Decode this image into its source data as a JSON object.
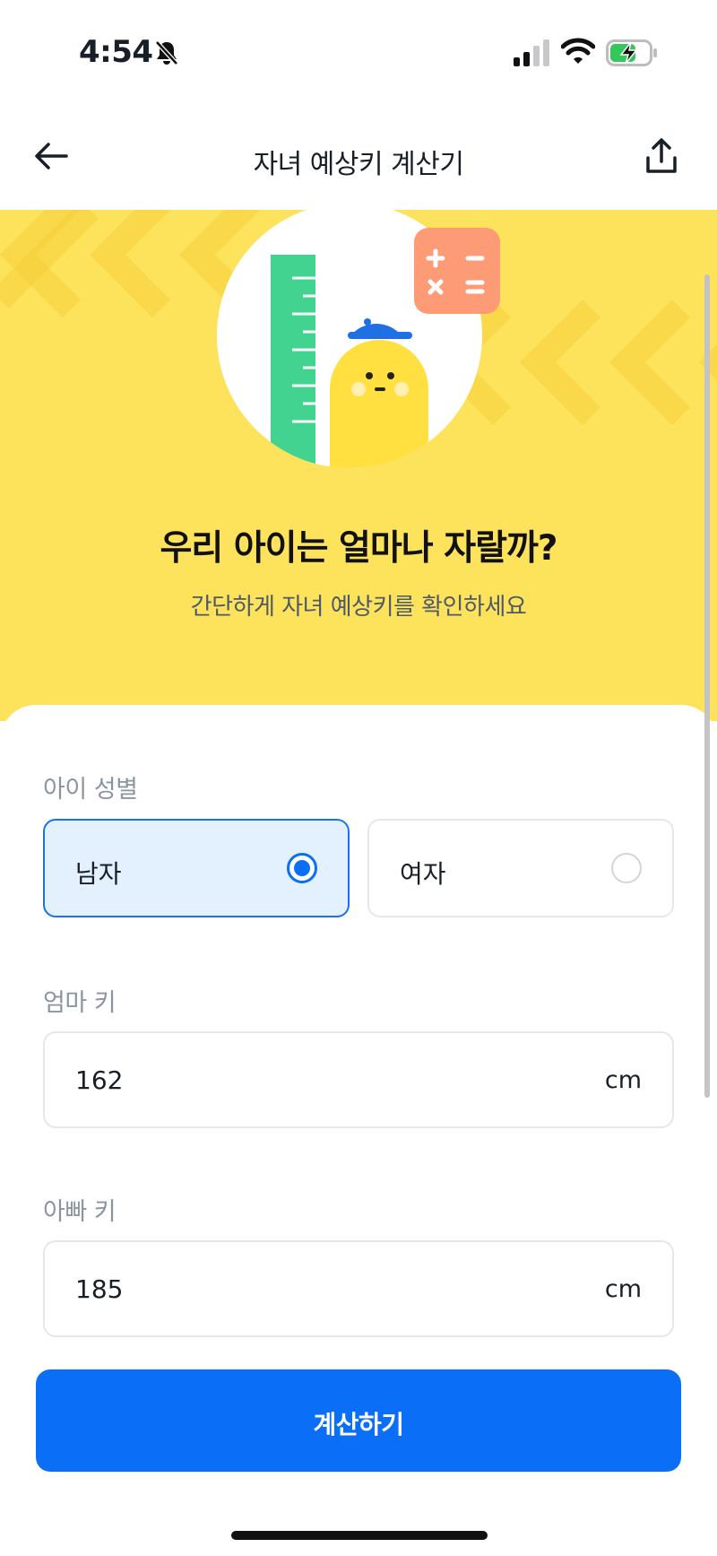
{
  "status_bar": {
    "time": "4:54",
    "icons": [
      "bell-slash-icon",
      "cellular-signal-icon",
      "wifi-icon",
      "battery-charging-icon"
    ]
  },
  "nav": {
    "title": "자녀 예상키 계산기",
    "back_icon": "arrow-left-icon",
    "share_icon": "share-icon"
  },
  "hero": {
    "title": "우리 아이는 얼마나 자랄까?",
    "subtitle": "간단하게 자녀 예상키를 확인하세요",
    "background_color": "#fde25b"
  },
  "form": {
    "gender": {
      "label": "아이 성별",
      "options": [
        {
          "label": "남자",
          "selected": true
        },
        {
          "label": "여자",
          "selected": false
        }
      ]
    },
    "mother_height": {
      "label": "엄마 키",
      "value": "162",
      "unit": "cm"
    },
    "father_height": {
      "label": "아빠 키",
      "value": "185",
      "unit": "cm"
    },
    "submit_label": "계산하기"
  },
  "colors": {
    "accent": "#0a6ff6",
    "selected_bg": "#e3f0fd",
    "muted_text": "#8b95a1"
  }
}
